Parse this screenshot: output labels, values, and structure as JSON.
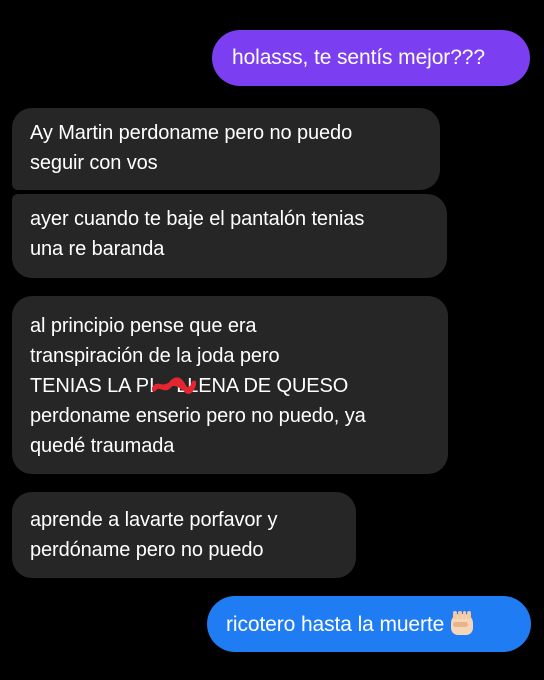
{
  "conversation": {
    "messages": [
      {
        "direction": "outgoing",
        "lines": [
          "holasss, te sentís mejor???"
        ],
        "color": "#7b3ef0"
      },
      {
        "direction": "incoming",
        "lines": [
          "Ay Martin perdoname pero no puedo",
          "seguir con vos"
        ]
      },
      {
        "direction": "incoming",
        "lines": [
          "ayer cuando te baje el pantalón tenias",
          "una re baranda"
        ]
      },
      {
        "direction": "incoming",
        "lines": [
          "al principio pense que era",
          "transpiración de la joda pero",
          "TENIAS LA PI",
          "LLENA DE QUESO",
          "perdoname enserio pero no puedo, ya",
          "quedé traumada"
        ]
      },
      {
        "direction": "incoming",
        "lines": [
          "aprende a lavarte porfavor y",
          "perdóname pero no puedo"
        ]
      },
      {
        "direction": "outgoing",
        "lines": [
          "ricotero hasta la muerte"
        ],
        "emoji": "raised-fist-light-skin-icon",
        "color": "#1f7cf2"
      }
    ],
    "incoming_bubble_color": "#262626",
    "redaction_color": "#e3262f"
  }
}
